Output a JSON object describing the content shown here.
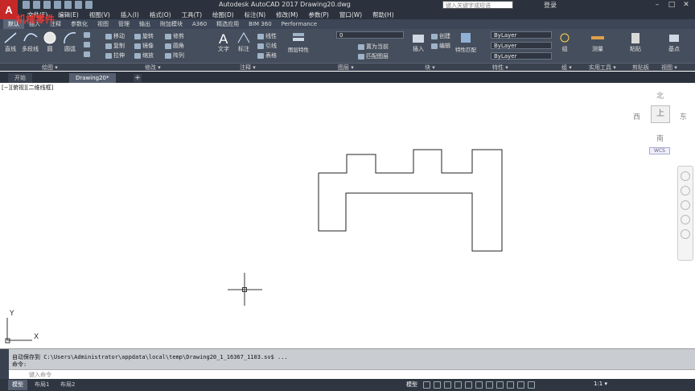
{
  "title_bar": {
    "logo": "A",
    "window_title": "Autodesk AutoCAD 2017    Drawing20.dwg",
    "search_placeholder": "键入关键字或短语",
    "user": "登录"
  },
  "overlay_title": "机械零件",
  "menu": [
    "文件(F)",
    "编辑(E)",
    "视图(V)",
    "插入(I)",
    "格式(O)",
    "工具(T)",
    "绘图(D)",
    "标注(N)",
    "修改(M)",
    "参数(P)",
    "窗口(W)",
    "帮助(H)"
  ],
  "ribbon_tabs": [
    "默认",
    "插入",
    "注释",
    "参数化",
    "视图",
    "管理",
    "输出",
    "附加模块",
    "A360",
    "精选应用",
    "BIM 360",
    "Performance"
  ],
  "ribbon": {
    "draw": {
      "line": "直线",
      "polyline": "多段线",
      "circle": "圆",
      "arc": "圆弧"
    },
    "modify": {
      "move": "移动",
      "rotate": "旋转",
      "trim": "修剪",
      "copy": "复制",
      "mirror": "镜像",
      "fillet": "圆角",
      "stretch": "拉伸",
      "scale": "缩放",
      "array": "阵列"
    },
    "annotation": {
      "text": "文字",
      "dimension": "标注",
      "linear": "线性",
      "leader": "引线",
      "table": "表格"
    },
    "layers": {
      "layer_props": "图层特性",
      "current_layer": "0",
      "set_current": "置为当前",
      "match_layer": "匹配图层"
    },
    "block": {
      "insert": "插入",
      "create": "创建",
      "edit": "编辑"
    },
    "properties": {
      "match": "特性匹配",
      "color": "ByLayer",
      "linetype": "ByLayer",
      "lineweight": "ByLayer"
    },
    "groups": {
      "group": "组"
    },
    "utilities": {
      "measure": "测量"
    },
    "clipboard": {
      "paste": "粘贴"
    },
    "view": {
      "base": "基点"
    }
  },
  "panel_labels": [
    "绘图 ▾",
    "修改 ▾",
    "注释 ▾",
    "图层 ▾",
    "块 ▾",
    "特性 ▾",
    "组 ▾",
    "实用工具 ▾",
    "剪贴板",
    "视图 ▾"
  ],
  "doc_tabs": {
    "start": "开始",
    "drawing": "Drawing20*"
  },
  "viewport_label": "[−][俯视][二维线框]",
  "viewcube": {
    "north": "北",
    "south": "南",
    "east": "东",
    "west": "西",
    "top": "上",
    "wcs": "WCS"
  },
  "ucs": {
    "x": "X",
    "y": "Y"
  },
  "command": {
    "line1": "自动保存到 C:\\Users\\Administrator\\appdata\\local\\temp\\Drawing20_1_16367_1103.sv$ ...",
    "line2": "命令:",
    "placeholder": "键入命令"
  },
  "status": {
    "tabs": [
      "模型",
      "布局1",
      "布局2"
    ],
    "model": "模型",
    "scale": "1:1 ▾"
  }
}
